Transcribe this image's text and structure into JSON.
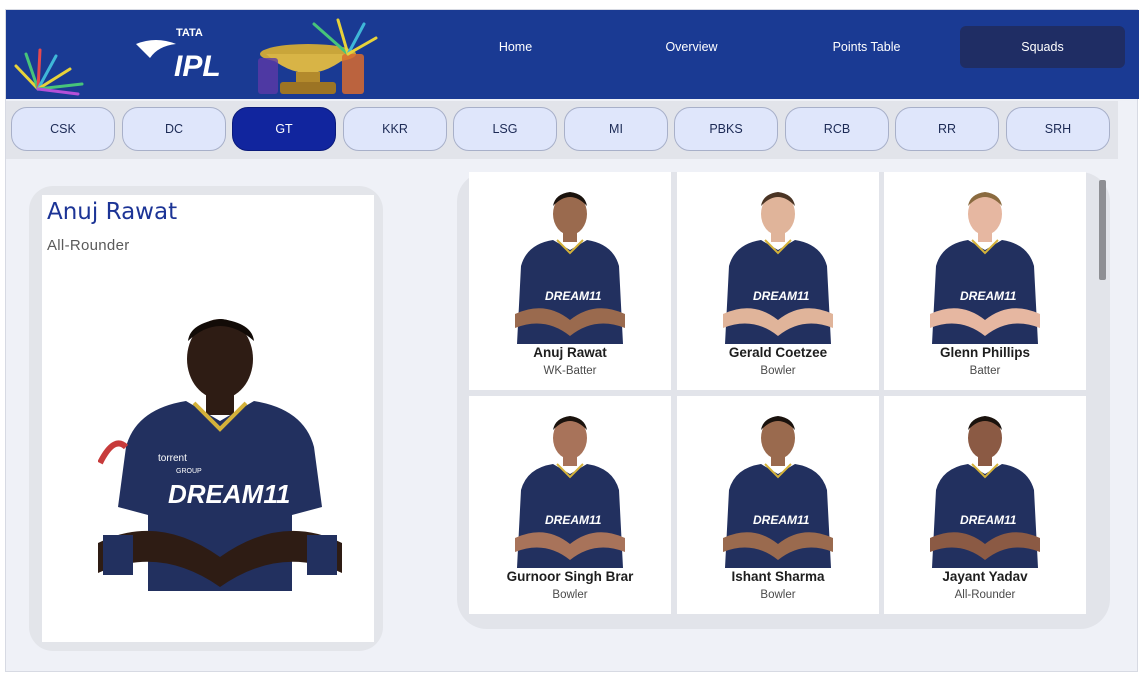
{
  "colors": {
    "header": "#1a3a93",
    "active_team": "#11259e",
    "nav_active": "#1f2d64",
    "team_pill": "#dfe6fb",
    "accent_text": "#1c3496"
  },
  "brand": {
    "logo_top": "TATA",
    "logo_main": "IPL"
  },
  "nav": [
    {
      "label": "Home",
      "active": false
    },
    {
      "label": "Overview",
      "active": false
    },
    {
      "label": "Points Table",
      "active": false
    },
    {
      "label": "Squads",
      "active": true
    }
  ],
  "teams": [
    {
      "label": "CSK",
      "active": false
    },
    {
      "label": "DC",
      "active": false
    },
    {
      "label": "GT",
      "active": true
    },
    {
      "label": "KKR",
      "active": false
    },
    {
      "label": "LSG",
      "active": false
    },
    {
      "label": "MI",
      "active": false
    },
    {
      "label": "PBKS",
      "active": false
    },
    {
      "label": "RCB",
      "active": false
    },
    {
      "label": "RR",
      "active": false
    },
    {
      "label": "SRH",
      "active": false
    }
  ],
  "selected_player": {
    "name": "Anuj Rawat",
    "role": "All-Rounder",
    "jersey_text": "DREAM11",
    "sponsor_text": "torrent",
    "sponsor_sub": "GROUP"
  },
  "players": [
    {
      "name": "Anuj Rawat",
      "role": "WK-Batter",
      "jersey_text": "DREAM11"
    },
    {
      "name": "Gerald Coetzee",
      "role": "Bowler",
      "jersey_text": "DREAM11"
    },
    {
      "name": "Glenn Phillips",
      "role": "Batter",
      "jersey_text": "DREAM11"
    },
    {
      "name": "Gurnoor Singh Brar",
      "role": "Bowler",
      "jersey_text": "DREAM11"
    },
    {
      "name": "Ishant Sharma",
      "role": "Bowler",
      "jersey_text": "DREAM11"
    },
    {
      "name": "Jayant Yadav",
      "role": "All-Rounder",
      "jersey_text": "DREAM11"
    }
  ]
}
